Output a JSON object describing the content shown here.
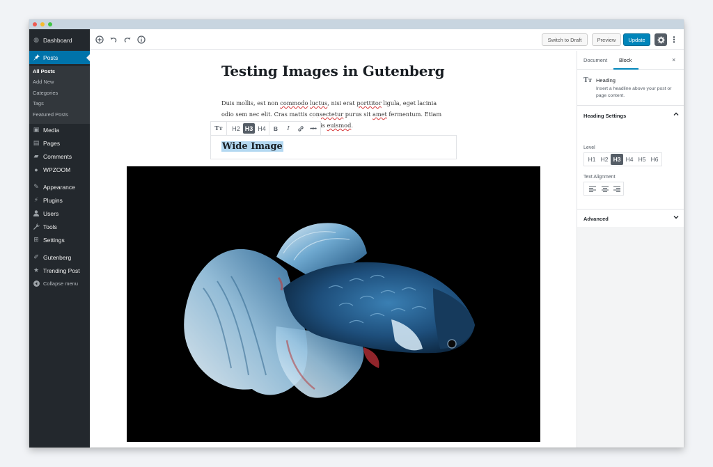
{
  "sidebar": {
    "items": [
      {
        "label": "Dashboard",
        "icon": "dashboard-icon",
        "glyph": "◍"
      },
      {
        "label": "Posts",
        "icon": "pin-icon",
        "glyph": "📌"
      },
      {
        "label": "Media",
        "icon": "media-icon",
        "glyph": "▣"
      },
      {
        "label": "Pages",
        "icon": "pages-icon",
        "glyph": "▤"
      },
      {
        "label": "Comments",
        "icon": "comments-icon",
        "glyph": "▰"
      },
      {
        "label": "WPZOOM",
        "icon": "wpzoom-icon",
        "glyph": "●"
      },
      {
        "label": "Appearance",
        "icon": "appearance-icon",
        "glyph": "✎"
      },
      {
        "label": "Plugins",
        "icon": "plugins-icon",
        "glyph": "⚡"
      },
      {
        "label": "Users",
        "icon": "users-icon",
        "glyph": "👤"
      },
      {
        "label": "Tools",
        "icon": "tools-icon",
        "glyph": "🔧"
      },
      {
        "label": "Settings",
        "icon": "settings-icon",
        "glyph": "⊞"
      },
      {
        "label": "Gutenberg",
        "icon": "gutenberg-icon",
        "glyph": "✐"
      },
      {
        "label": "Trending Post",
        "icon": "star-icon",
        "glyph": "★"
      },
      {
        "label": "Collapse menu",
        "icon": "collapse-icon",
        "glyph": "◀"
      }
    ],
    "posts_submenu": [
      "All Posts",
      "Add New",
      "Categories",
      "Tags",
      "Featured Posts"
    ]
  },
  "toolbar": {
    "switch_label": "Switch to Draft",
    "preview_label": "Preview",
    "update_label": "Update"
  },
  "editor": {
    "title": "Testing Images in Gutenberg",
    "paragraph": {
      "line1_a": "Duis mollis, est non ",
      "line1_b": "commodo",
      "line1_c": " ",
      "line1_d": "luctus",
      "line1_e": ", nisi erat ",
      "line1_f": "porttitor",
      "line1_g": " ligula, eget lacinia",
      "line2_a": "odio sem nec elit. Cras mattis ",
      "line2_b": "consectetur",
      "line2_c": " purus sit ",
      "line2_d": "amet",
      "line2_e": " fermentum. Etiam",
      "line3_a": "is ",
      "line3_b": "euismod",
      "line3_c": "."
    },
    "block_toolbar": {
      "type_label": "Tт",
      "levels": [
        "H2",
        "H3",
        "H4"
      ],
      "selected_level": "H3",
      "bold": "B",
      "italic": "I",
      "strike": "ABC"
    },
    "heading": "Wide Image"
  },
  "settings": {
    "tabs": [
      "Document",
      "Block"
    ],
    "active_tab": "Block",
    "close": "×",
    "block_name": "Heading",
    "block_icon": "Tт",
    "block_desc": "Insert a headline above your post or page content.",
    "heading_settings": "Heading Settings",
    "level_label": "Level",
    "levels": [
      "H1",
      "H2",
      "H3",
      "H4",
      "H5",
      "H6"
    ],
    "selected_level": "H3",
    "alignment_label": "Text Alignment",
    "advanced": "Advanced"
  },
  "colors": {
    "admin_bg": "#23282d",
    "accent": "#0073aa",
    "primary_button": "#0085ba",
    "selection": "#b3d8f1"
  }
}
